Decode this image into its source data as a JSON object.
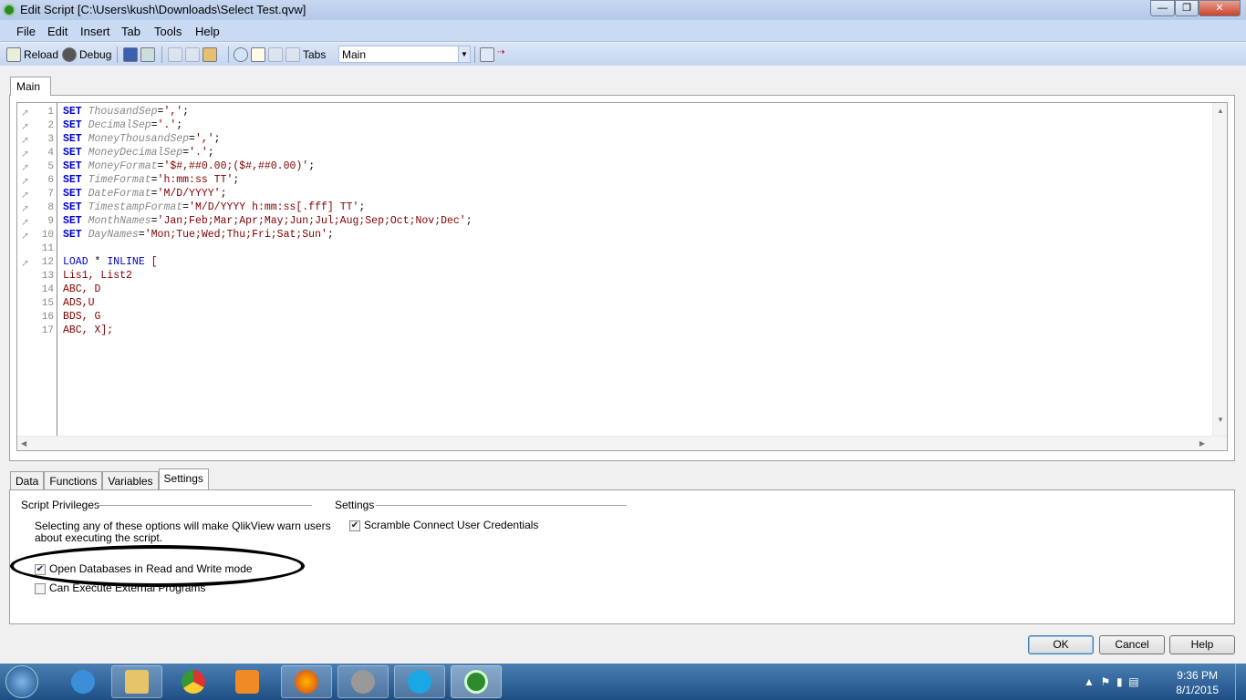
{
  "window": {
    "title": "Edit Script [C:\\Users\\kush\\Downloads\\Select Test.qvw]",
    "minimize": "—",
    "maximize": "❐",
    "close": "✕"
  },
  "menu": [
    "File",
    "Edit",
    "Insert",
    "Tab",
    "Tools",
    "Help"
  ],
  "toolbar": {
    "reload": "Reload",
    "debug": "Debug",
    "tabs_label": "Tabs",
    "tab_select": "Main"
  },
  "script_tab": "Main",
  "code": [
    {
      "n": "1",
      "t": [
        [
          "kw",
          "SET"
        ],
        [
          "op",
          " "
        ],
        [
          "var",
          "ThousandSep"
        ],
        [
          "op",
          "="
        ],
        [
          "str",
          "','"
        ],
        [
          "op",
          ";"
        ]
      ]
    },
    {
      "n": "2",
      "t": [
        [
          "kw",
          "SET"
        ],
        [
          "op",
          " "
        ],
        [
          "var",
          "DecimalSep"
        ],
        [
          "op",
          "="
        ],
        [
          "str",
          "'.'"
        ],
        [
          "op",
          ";"
        ]
      ]
    },
    {
      "n": "3",
      "t": [
        [
          "kw",
          "SET"
        ],
        [
          "op",
          " "
        ],
        [
          "var",
          "MoneyThousandSep"
        ],
        [
          "op",
          "="
        ],
        [
          "str",
          "','"
        ],
        [
          "op",
          ";"
        ]
      ]
    },
    {
      "n": "4",
      "t": [
        [
          "kw",
          "SET"
        ],
        [
          "op",
          " "
        ],
        [
          "var",
          "MoneyDecimalSep"
        ],
        [
          "op",
          "="
        ],
        [
          "str",
          "'.'"
        ],
        [
          "op",
          ";"
        ]
      ]
    },
    {
      "n": "5",
      "t": [
        [
          "kw",
          "SET"
        ],
        [
          "op",
          " "
        ],
        [
          "var",
          "MoneyFormat"
        ],
        [
          "op",
          "="
        ],
        [
          "str",
          "'$#,##0.00;($#,##0.00)'"
        ],
        [
          "op",
          ";"
        ]
      ]
    },
    {
      "n": "6",
      "t": [
        [
          "kw",
          "SET"
        ],
        [
          "op",
          " "
        ],
        [
          "var",
          "TimeFormat"
        ],
        [
          "op",
          "="
        ],
        [
          "str",
          "'h:mm:ss TT'"
        ],
        [
          "op",
          ";"
        ]
      ]
    },
    {
      "n": "7",
      "t": [
        [
          "kw",
          "SET"
        ],
        [
          "op",
          " "
        ],
        [
          "var",
          "DateFormat"
        ],
        [
          "op",
          "="
        ],
        [
          "str",
          "'M/D/YYYY'"
        ],
        [
          "op",
          ";"
        ]
      ]
    },
    {
      "n": "8",
      "t": [
        [
          "kw",
          "SET"
        ],
        [
          "op",
          " "
        ],
        [
          "var",
          "TimestampFormat"
        ],
        [
          "op",
          "="
        ],
        [
          "str",
          "'M/D/YYYY h:mm:ss[.fff] TT'"
        ],
        [
          "op",
          ";"
        ]
      ]
    },
    {
      "n": "9",
      "t": [
        [
          "kw",
          "SET"
        ],
        [
          "op",
          " "
        ],
        [
          "var",
          "MonthNames"
        ],
        [
          "op",
          "="
        ],
        [
          "str",
          "'Jan;Feb;Mar;Apr;May;Jun;Jul;Aug;Sep;Oct;Nov;Dec'"
        ],
        [
          "op",
          ";"
        ]
      ]
    },
    {
      "n": "10",
      "t": [
        [
          "kw",
          "SET"
        ],
        [
          "op",
          " "
        ],
        [
          "var",
          "DayNames"
        ],
        [
          "op",
          "="
        ],
        [
          "str",
          "'Mon;Tue;Wed;Thu;Fri;Sat;Sun'"
        ],
        [
          "op",
          ";"
        ]
      ]
    },
    {
      "n": "11",
      "t": []
    },
    {
      "n": "12",
      "t": [
        [
          "kw2",
          "LOAD"
        ],
        [
          "op",
          " * "
        ],
        [
          "kw2",
          "INLINE"
        ],
        [
          "str",
          " ["
        ]
      ]
    },
    {
      "n": "13",
      "t": [
        [
          "str",
          "Lis1, List2"
        ]
      ]
    },
    {
      "n": "14",
      "t": [
        [
          "str",
          "ABC, D"
        ]
      ]
    },
    {
      "n": "15",
      "t": [
        [
          "str",
          "ADS,U"
        ]
      ]
    },
    {
      "n": "16",
      "t": [
        [
          "str",
          "BDS, G"
        ]
      ]
    },
    {
      "n": "17",
      "t": [
        [
          "str",
          "ABC, X];"
        ]
      ]
    }
  ],
  "bottom_tabs": [
    "Data",
    "Functions",
    "Variables",
    "Settings"
  ],
  "settings": {
    "privileges_title": "Script Privileges",
    "privileges_desc_1": "Selecting any of these options will make QlikView warn users",
    "privileges_desc_2": "about executing the script.",
    "open_db": {
      "label": "Open Databases in Read and Write mode",
      "checked": true
    },
    "exec_programs": {
      "label": "Can Execute External Programs",
      "checked": false
    },
    "settings_title": "Settings",
    "scramble": {
      "label": "Scramble Connect User Credentials",
      "checked": true
    }
  },
  "buttons": {
    "ok": "OK",
    "cancel": "Cancel",
    "help": "Help"
  },
  "taskbar": {
    "time": "9:36 PM",
    "date": "8/1/2015",
    "apps": [
      "internet-explorer",
      "file-explorer",
      "chrome",
      "media-player",
      "firefox",
      "media-center",
      "skype",
      "qlikview"
    ]
  }
}
